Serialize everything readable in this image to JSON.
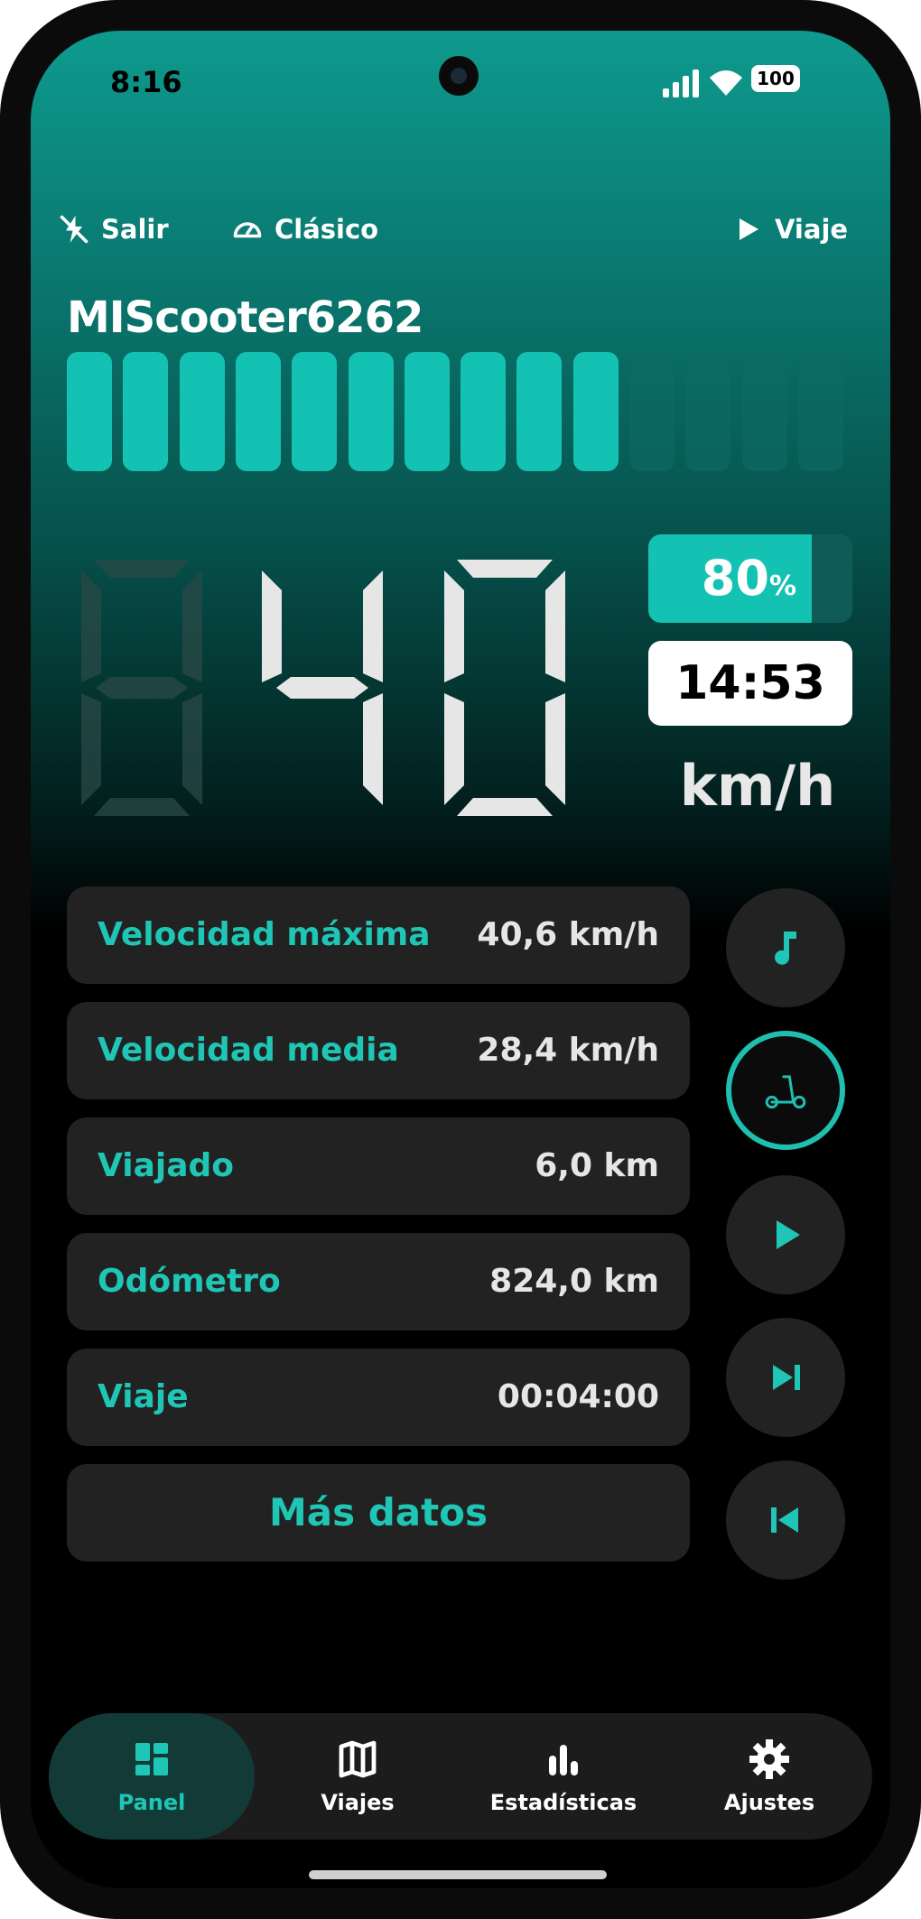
{
  "status_bar": {
    "time": "8:16",
    "battery": "100",
    "icons": [
      "signal-icon",
      "wifi-icon",
      "battery-icon"
    ]
  },
  "top_bar": {
    "exit": {
      "label": "Salir",
      "icon": "exit-icon"
    },
    "mode": {
      "label": "Clásico",
      "icon": "gauge-icon"
    },
    "trip": {
      "label": "Viaje",
      "icon": "play-icon"
    }
  },
  "scooter_name": "MIScooter6262",
  "speed_meter": {
    "active_segments": 10,
    "total_segments": 14
  },
  "speed": {
    "digits": [
      "0",
      "4",
      "0"
    ],
    "dimmed_leading": true,
    "unit": "km/h"
  },
  "battery_level": {
    "value": "80",
    "suffix": "%",
    "fraction": 0.8
  },
  "clock": "14:53",
  "stats": [
    {
      "label": "Velocidad máxima",
      "value": "40,6 km/h"
    },
    {
      "label": "Velocidad media",
      "value": "28,4 km/h"
    },
    {
      "label": "Viajado",
      "value": "6,0 km"
    },
    {
      "label": "Odómetro",
      "value": "824,0 km"
    },
    {
      "label": "Viaje",
      "value": "00:04:00"
    }
  ],
  "more_button": "Más datos",
  "controls": [
    "music-note-icon",
    "scooter-icon",
    "play-icon",
    "skip-next-icon",
    "skip-previous-icon"
  ],
  "bottom_nav": [
    {
      "label": "Panel",
      "icon": "dashboard-icon",
      "active": true
    },
    {
      "label": "Viajes",
      "icon": "map-icon",
      "active": false
    },
    {
      "label": "Estadísticas",
      "icon": "bar-chart-icon",
      "active": false
    },
    {
      "label": "Ajustes",
      "icon": "gear-icon",
      "active": false
    }
  ],
  "colors": {
    "accent": "#1fc6b5",
    "segment_on": "#14c2b3",
    "segment_off": "#0e6b65",
    "card": "#222222"
  }
}
